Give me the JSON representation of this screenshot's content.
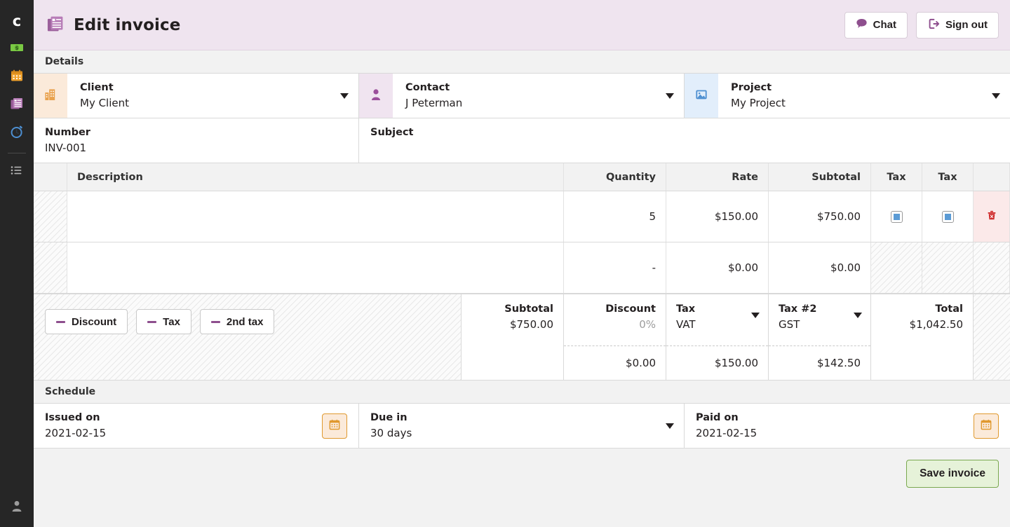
{
  "sidebar": {
    "logo": "c",
    "items": [
      {
        "name": "money-icon",
        "label": "Money"
      },
      {
        "name": "calendar-icon",
        "label": "Calendar"
      },
      {
        "name": "invoices-icon",
        "label": "Invoices"
      },
      {
        "name": "timer-icon",
        "label": "Timer"
      },
      {
        "name": "list-icon",
        "label": "List"
      }
    ],
    "account": "Account"
  },
  "header": {
    "title": "Edit invoice",
    "chat_label": "Chat",
    "signout_label": "Sign out"
  },
  "details": {
    "section_label": "Details",
    "client": {
      "label": "Client",
      "value": "My Client"
    },
    "contact": {
      "label": "Contact",
      "value": "J Peterman"
    },
    "project": {
      "label": "Project",
      "value": "My Project"
    },
    "number": {
      "label": "Number",
      "value": "INV-001"
    },
    "subject": {
      "label": "Subject",
      "value": ""
    }
  },
  "items": {
    "columns": [
      "Description",
      "Quantity",
      "Rate",
      "Subtotal",
      "Tax",
      "Tax"
    ],
    "rows": [
      {
        "description": "",
        "quantity": "5",
        "rate": "$150.00",
        "subtotal": "$750.00",
        "tax1_checked": true,
        "tax2_checked": true,
        "deletable": true
      },
      {
        "description": "",
        "quantity": "-",
        "rate": "$0.00",
        "subtotal": "$0.00",
        "tax1_checked": false,
        "tax2_checked": false,
        "deletable": false
      }
    ]
  },
  "totals": {
    "add_discount_label": "Discount",
    "add_tax_label": "Tax",
    "add_2nd_tax_label": "2nd tax",
    "subtotal_label": "Subtotal",
    "subtotal_value": "$750.00",
    "discount_label": "Discount",
    "discount_value": "0%",
    "discount_amount": "$0.00",
    "tax_label": "Tax",
    "tax_value": "VAT",
    "tax_amount": "$150.00",
    "tax2_label": "Tax #2",
    "tax2_value": "GST",
    "tax2_amount": "$142.50",
    "total_label": "Total",
    "total_value": "$1,042.50"
  },
  "schedule": {
    "section_label": "Schedule",
    "issued_on": {
      "label": "Issued on",
      "value": "2021-02-15"
    },
    "due_in": {
      "label": "Due in",
      "value": "30 days"
    },
    "paid_on": {
      "label": "Paid on",
      "value": "2021-02-15"
    }
  },
  "footer": {
    "save_label": "Save invoice"
  },
  "colors": {
    "header_bg": "#efe4ef",
    "accent_purple": "#8e4f8e",
    "accent_orange": "#e0992f",
    "accent_blue": "#5b9bd5",
    "accent_green": "#7aa84f",
    "danger_red": "#cf2b2b",
    "sidebar_bg": "#262626"
  }
}
